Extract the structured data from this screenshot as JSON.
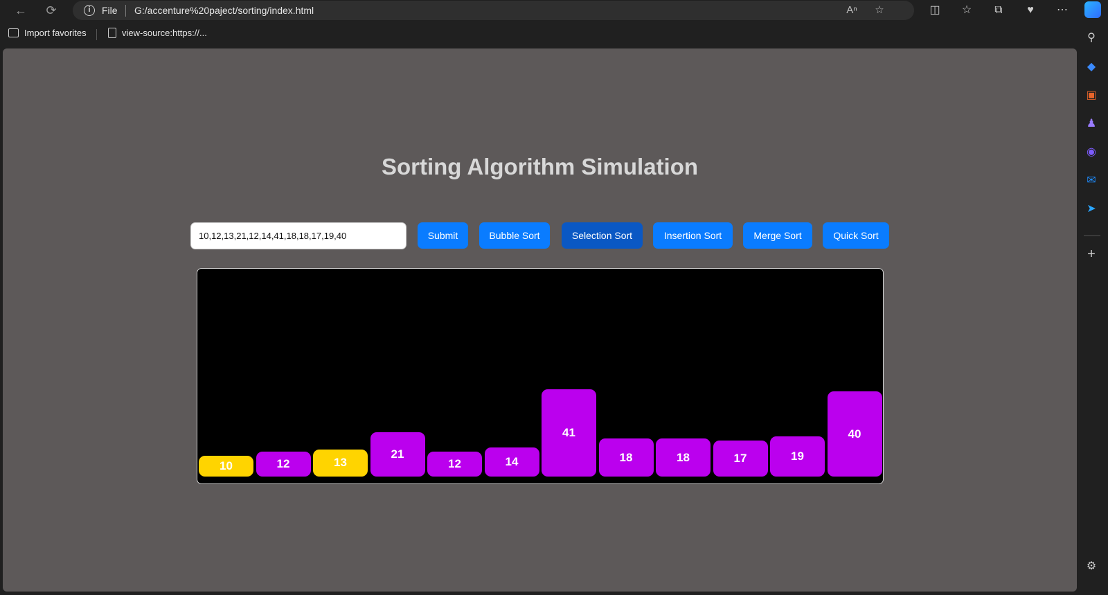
{
  "browser": {
    "file_label": "File",
    "url": "G:/accenture%20paject/sorting/index.html",
    "favorites": [
      {
        "label": "Import favorites"
      },
      {
        "label": "view-source:https://..."
      }
    ]
  },
  "page": {
    "title": "Sorting Algorithm Simulation",
    "input_value": "10,12,13,21,12,14,41,18,18,17,19,40",
    "buttons": {
      "submit": "Submit",
      "bubble": "Bubble Sort",
      "selection": "Selection Sort",
      "insertion": "Insertion Sort",
      "merge": "Merge Sort",
      "quick": "Quick Sort"
    },
    "active_button": "selection"
  },
  "colors": {
    "bar_default": "#bb00ee",
    "bar_highlight": "#ffd400",
    "highlight_text": "#ffffff",
    "button": "#0a7cff",
    "button_active": "#0a58c4"
  },
  "chart_data": {
    "type": "bar",
    "values": [
      10,
      12,
      13,
      21,
      12,
      14,
      41,
      18,
      18,
      17,
      19,
      40
    ],
    "highlighted_indices": [
      0,
      2
    ]
  }
}
